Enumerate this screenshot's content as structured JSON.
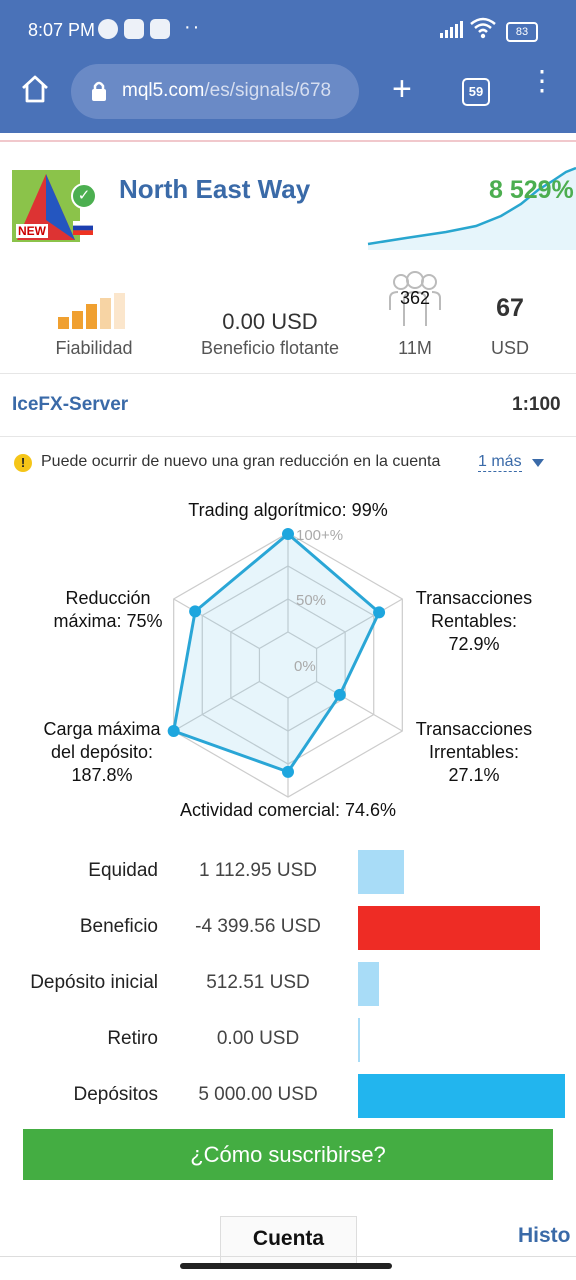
{
  "status": {
    "time": "8:07 PM",
    "dots": "··",
    "battery": "83"
  },
  "browser": {
    "url_main": "mql5.com",
    "url_rest": "/es/signals/678",
    "tab_count": "59"
  },
  "signal": {
    "name": "North East Way",
    "growth": "8 529%",
    "logo_badge": "NEW"
  },
  "stats": {
    "reliability_label": "Fiabilidad",
    "floating_value": "0.00 USD",
    "floating_label": "Beneficio flotante",
    "subscribers_count": "362",
    "subscribers_label": "11M",
    "price_value": "67",
    "price_label": "USD"
  },
  "server": {
    "name": "IceFX-Server",
    "leverage": "1:100"
  },
  "warning": {
    "text": "Puede ocurrir de nuevo una gran reducción en la cuenta",
    "more": "1 más"
  },
  "radar": {
    "labels": {
      "top": "Trading algorítmico: 99%",
      "upper_right_1": "Transacciones",
      "upper_right_2": "Rentables:",
      "upper_right_3": "72.9%",
      "lower_right_1": "Transacciones",
      "lower_right_2": "Irrentables:",
      "lower_right_3": "27.1%",
      "bottom": "Actividad comercial: 74.6%",
      "lower_left_1": "Carga máxima",
      "lower_left_2": "del depósito:",
      "lower_left_3": "187.8%",
      "upper_left_1": "Reducción",
      "upper_left_2": "máxima: 75%"
    },
    "scale": {
      "outer": "100+%",
      "mid": "50%",
      "inner": "0%"
    },
    "values": [
      99,
      72.9,
      27.1,
      74.6,
      100,
      75
    ]
  },
  "finance": [
    {
      "label": "Equidad",
      "value": "1 112.95 USD",
      "fraction": 0.223,
      "color": "#a8dcf7"
    },
    {
      "label": "Beneficio",
      "value": "-4 399.56 USD",
      "fraction": 0.88,
      "color": "#ee2c25"
    },
    {
      "label": "Depósito inicial",
      "value": "512.51 USD",
      "fraction": 0.103,
      "color": "#a8dcf7"
    },
    {
      "label": "Retiro",
      "value": "0.00 USD",
      "fraction": 0.0,
      "color": "#a8dcf7"
    },
    {
      "label": "Depósitos",
      "value": "5 000.00 USD",
      "fraction": 1.0,
      "color": "#22b5ee"
    }
  ],
  "actions": {
    "subscribe": "¿Cómo suscribirse?"
  },
  "tabs": {
    "account": "Cuenta",
    "history": "Histo"
  },
  "colors": {
    "browser_bar": "#4a72b8",
    "accent": "#3a6aa8",
    "growth": "#4cae50",
    "subscribe": "#44ad42"
  }
}
